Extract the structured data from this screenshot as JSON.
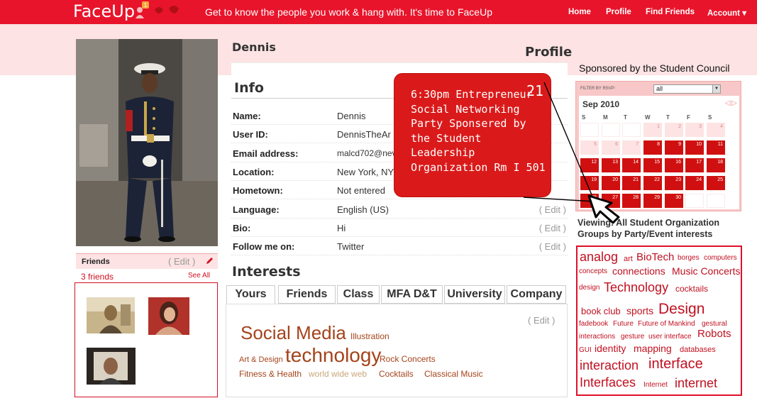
{
  "header": {
    "logo": "FaceUp",
    "notification_count": "1",
    "tagline": "Get to know the people you work & hang with. It's time to FaceUp",
    "nav": {
      "home": "Home",
      "profile": "Profile",
      "find_friends": "Find Friends",
      "account": "Account ▾"
    }
  },
  "profile": {
    "name": "Dennis",
    "section_title": "Profile",
    "info_title": "Info",
    "fields": [
      {
        "label": "Name:",
        "value": "Dennis",
        "edit": ""
      },
      {
        "label": "User ID:",
        "value": "DennisTheAr",
        "edit": ""
      },
      {
        "label": "Email address:",
        "value": "malcd702@nev",
        "edit": ""
      },
      {
        "label": "Location:",
        "value": "New York, NY",
        "edit": ""
      },
      {
        "label": "Hometown:",
        "value": "Not entered",
        "edit": ""
      },
      {
        "label": "Language:",
        "value": "English (US)",
        "edit": "( Edit )"
      },
      {
        "label": "Bio:",
        "value": "Hi",
        "edit": "( Edit )"
      },
      {
        "label": "Follow me on:",
        "value": "Twitter",
        "edit": "( Edit )"
      }
    ],
    "name_edit_partial": ")"
  },
  "friends": {
    "title": "Friends",
    "edit": "( Edit )",
    "count": "3 friends",
    "see_all": "See All"
  },
  "interests": {
    "title": "Interests",
    "tabs": [
      "Yours",
      "Friends",
      "Class",
      "MFA D&T",
      "University",
      "Company"
    ],
    "edit": "( Edit )",
    "tags": [
      "Social Media",
      "Illustration",
      "Art & Design",
      "technology",
      "Rock Concerts",
      "Fitness & Health",
      "world wide web",
      "Cocktails",
      "Classical Music"
    ]
  },
  "event_popup": {
    "day": "21",
    "text": "6:30pm Entrepreneur Social Networking Party Sponsered by the Student Leadership Organization Rm I 501"
  },
  "calendar": {
    "sponsor_title": "Sponsored by the Student Council",
    "filter_label": "FILTER BY RSVP:",
    "filter_value": "all",
    "month": "Sep 2010",
    "prev": "◁",
    "next": "▷",
    "days_of_week": [
      "S",
      "M",
      "T",
      "W",
      "T",
      "F",
      "S"
    ],
    "dates": [
      "",
      "",
      "",
      "1",
      "2",
      "3",
      "4",
      "5",
      "6",
      "7",
      "8",
      "9",
      "10",
      "11",
      "12",
      "13",
      "14",
      "15",
      "16",
      "17",
      "18",
      "19",
      "20",
      "21",
      "22",
      "23",
      "24",
      "25",
      "26",
      "27",
      "28",
      "29",
      "30",
      "",
      ""
    ],
    "event_days": [
      8,
      9,
      10,
      11,
      12,
      13,
      14,
      15,
      16,
      17,
      18,
      19,
      20,
      21,
      22,
      23,
      24,
      25,
      26,
      27,
      28,
      29,
      30
    ]
  },
  "groups": {
    "viewing": "Viewing: All Student Organization Groups by Party/Event interests",
    "cloud": [
      "analog",
      "art",
      "BioTech",
      "borges",
      "computers",
      "concepts",
      "connections",
      "Music Concerts",
      "design",
      "Technology",
      "cocktails",
      "book club",
      "sports",
      "Design",
      "fadebook",
      "Future",
      "Future of Mankind",
      "gestural",
      "interactions",
      "gesture",
      "user interface",
      "Robots",
      "GUI",
      "identity",
      "mapping",
      "databases",
      "interaction",
      "interface",
      "Interfaces",
      "Internet",
      "internet"
    ]
  },
  "colors": {
    "brand": "#e8142b",
    "band": "#fde3e3",
    "event": "#d01010",
    "tag": "#a5431a"
  }
}
